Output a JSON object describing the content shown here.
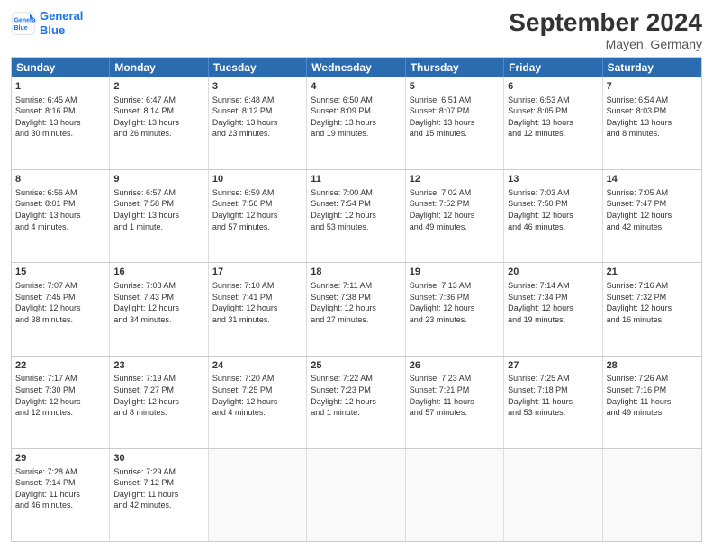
{
  "logo": {
    "line1": "General",
    "line2": "Blue"
  },
  "title": "September 2024",
  "subtitle": "Mayen, Germany",
  "days": [
    "Sunday",
    "Monday",
    "Tuesday",
    "Wednesday",
    "Thursday",
    "Friday",
    "Saturday"
  ],
  "weeks": [
    [
      {
        "day": "1",
        "lines": [
          "Sunrise: 6:45 AM",
          "Sunset: 8:16 PM",
          "Daylight: 13 hours",
          "and 30 minutes."
        ]
      },
      {
        "day": "2",
        "lines": [
          "Sunrise: 6:47 AM",
          "Sunset: 8:14 PM",
          "Daylight: 13 hours",
          "and 26 minutes."
        ]
      },
      {
        "day": "3",
        "lines": [
          "Sunrise: 6:48 AM",
          "Sunset: 8:12 PM",
          "Daylight: 13 hours",
          "and 23 minutes."
        ]
      },
      {
        "day": "4",
        "lines": [
          "Sunrise: 6:50 AM",
          "Sunset: 8:09 PM",
          "Daylight: 13 hours",
          "and 19 minutes."
        ]
      },
      {
        "day": "5",
        "lines": [
          "Sunrise: 6:51 AM",
          "Sunset: 8:07 PM",
          "Daylight: 13 hours",
          "and 15 minutes."
        ]
      },
      {
        "day": "6",
        "lines": [
          "Sunrise: 6:53 AM",
          "Sunset: 8:05 PM",
          "Daylight: 13 hours",
          "and 12 minutes."
        ]
      },
      {
        "day": "7",
        "lines": [
          "Sunrise: 6:54 AM",
          "Sunset: 8:03 PM",
          "Daylight: 13 hours",
          "and 8 minutes."
        ]
      }
    ],
    [
      {
        "day": "8",
        "lines": [
          "Sunrise: 6:56 AM",
          "Sunset: 8:01 PM",
          "Daylight: 13 hours",
          "and 4 minutes."
        ]
      },
      {
        "day": "9",
        "lines": [
          "Sunrise: 6:57 AM",
          "Sunset: 7:58 PM",
          "Daylight: 13 hours",
          "and 1 minute."
        ]
      },
      {
        "day": "10",
        "lines": [
          "Sunrise: 6:59 AM",
          "Sunset: 7:56 PM",
          "Daylight: 12 hours",
          "and 57 minutes."
        ]
      },
      {
        "day": "11",
        "lines": [
          "Sunrise: 7:00 AM",
          "Sunset: 7:54 PM",
          "Daylight: 12 hours",
          "and 53 minutes."
        ]
      },
      {
        "day": "12",
        "lines": [
          "Sunrise: 7:02 AM",
          "Sunset: 7:52 PM",
          "Daylight: 12 hours",
          "and 49 minutes."
        ]
      },
      {
        "day": "13",
        "lines": [
          "Sunrise: 7:03 AM",
          "Sunset: 7:50 PM",
          "Daylight: 12 hours",
          "and 46 minutes."
        ]
      },
      {
        "day": "14",
        "lines": [
          "Sunrise: 7:05 AM",
          "Sunset: 7:47 PM",
          "Daylight: 12 hours",
          "and 42 minutes."
        ]
      }
    ],
    [
      {
        "day": "15",
        "lines": [
          "Sunrise: 7:07 AM",
          "Sunset: 7:45 PM",
          "Daylight: 12 hours",
          "and 38 minutes."
        ]
      },
      {
        "day": "16",
        "lines": [
          "Sunrise: 7:08 AM",
          "Sunset: 7:43 PM",
          "Daylight: 12 hours",
          "and 34 minutes."
        ]
      },
      {
        "day": "17",
        "lines": [
          "Sunrise: 7:10 AM",
          "Sunset: 7:41 PM",
          "Daylight: 12 hours",
          "and 31 minutes."
        ]
      },
      {
        "day": "18",
        "lines": [
          "Sunrise: 7:11 AM",
          "Sunset: 7:38 PM",
          "Daylight: 12 hours",
          "and 27 minutes."
        ]
      },
      {
        "day": "19",
        "lines": [
          "Sunrise: 7:13 AM",
          "Sunset: 7:36 PM",
          "Daylight: 12 hours",
          "and 23 minutes."
        ]
      },
      {
        "day": "20",
        "lines": [
          "Sunrise: 7:14 AM",
          "Sunset: 7:34 PM",
          "Daylight: 12 hours",
          "and 19 minutes."
        ]
      },
      {
        "day": "21",
        "lines": [
          "Sunrise: 7:16 AM",
          "Sunset: 7:32 PM",
          "Daylight: 12 hours",
          "and 16 minutes."
        ]
      }
    ],
    [
      {
        "day": "22",
        "lines": [
          "Sunrise: 7:17 AM",
          "Sunset: 7:30 PM",
          "Daylight: 12 hours",
          "and 12 minutes."
        ]
      },
      {
        "day": "23",
        "lines": [
          "Sunrise: 7:19 AM",
          "Sunset: 7:27 PM",
          "Daylight: 12 hours",
          "and 8 minutes."
        ]
      },
      {
        "day": "24",
        "lines": [
          "Sunrise: 7:20 AM",
          "Sunset: 7:25 PM",
          "Daylight: 12 hours",
          "and 4 minutes."
        ]
      },
      {
        "day": "25",
        "lines": [
          "Sunrise: 7:22 AM",
          "Sunset: 7:23 PM",
          "Daylight: 12 hours",
          "and 1 minute."
        ]
      },
      {
        "day": "26",
        "lines": [
          "Sunrise: 7:23 AM",
          "Sunset: 7:21 PM",
          "Daylight: 11 hours",
          "and 57 minutes."
        ]
      },
      {
        "day": "27",
        "lines": [
          "Sunrise: 7:25 AM",
          "Sunset: 7:18 PM",
          "Daylight: 11 hours",
          "and 53 minutes."
        ]
      },
      {
        "day": "28",
        "lines": [
          "Sunrise: 7:26 AM",
          "Sunset: 7:16 PM",
          "Daylight: 11 hours",
          "and 49 minutes."
        ]
      }
    ],
    [
      {
        "day": "29",
        "lines": [
          "Sunrise: 7:28 AM",
          "Sunset: 7:14 PM",
          "Daylight: 11 hours",
          "and 46 minutes."
        ]
      },
      {
        "day": "30",
        "lines": [
          "Sunrise: 7:29 AM",
          "Sunset: 7:12 PM",
          "Daylight: 11 hours",
          "and 42 minutes."
        ]
      },
      {
        "day": "",
        "lines": []
      },
      {
        "day": "",
        "lines": []
      },
      {
        "day": "",
        "lines": []
      },
      {
        "day": "",
        "lines": []
      },
      {
        "day": "",
        "lines": []
      }
    ]
  ]
}
